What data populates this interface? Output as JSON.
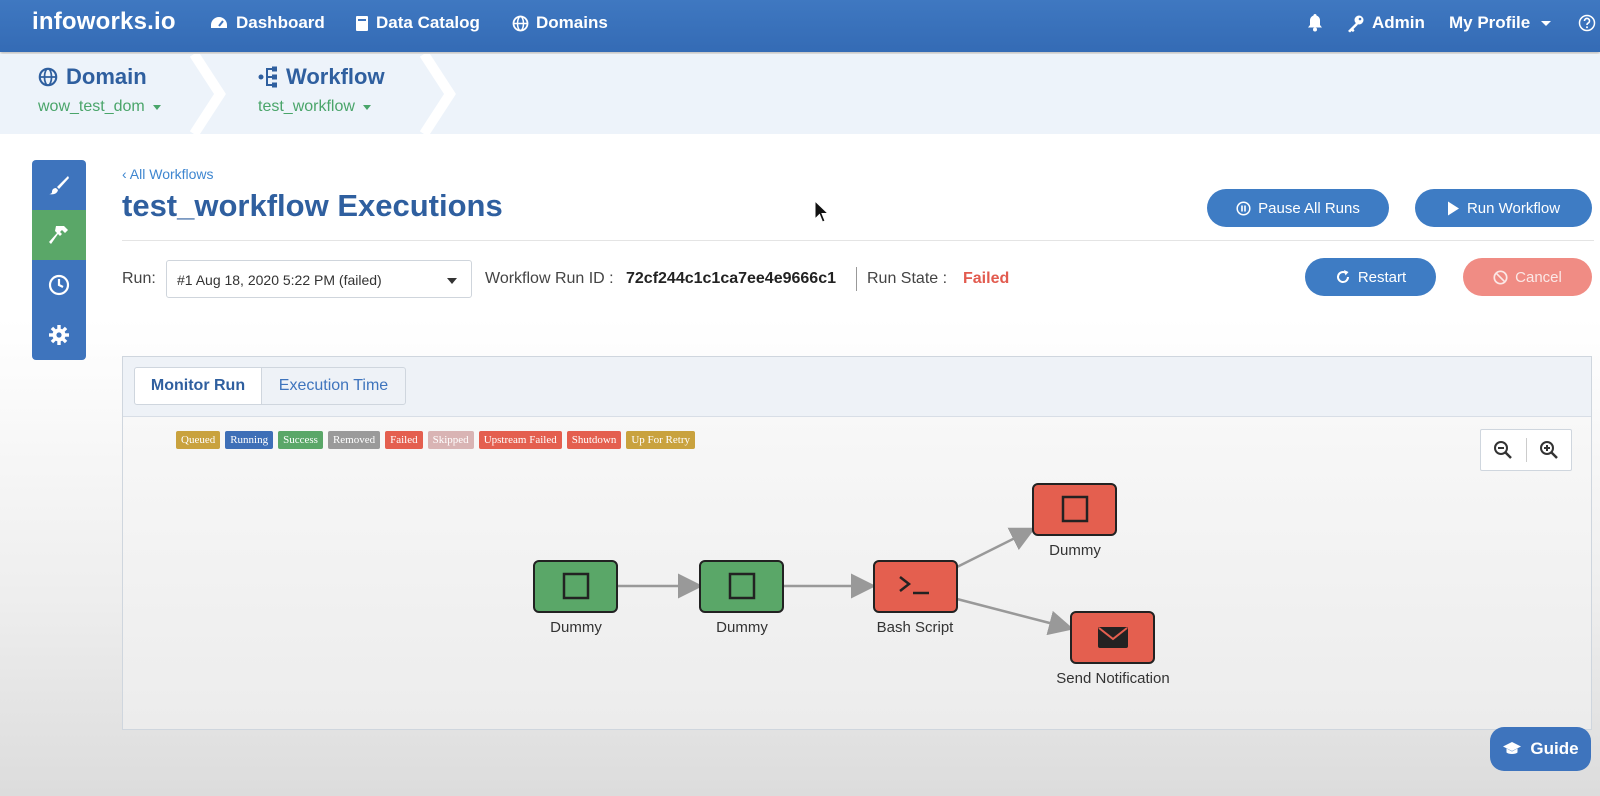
{
  "topnav": {
    "brand": "infoworks.io",
    "dashboard": "Dashboard",
    "data_catalog": "Data Catalog",
    "domains": "Domains",
    "admin": "Admin",
    "my_profile": "My Profile",
    "icons": {
      "bell": "bell-icon",
      "help": "help-icon",
      "key": "key-icon"
    }
  },
  "breadcrumb": {
    "domain_title": "Domain",
    "domain_value": "wow_test_dom",
    "workflow_title": "Workflow",
    "workflow_value": "test_workflow"
  },
  "rail": [
    "brush-icon",
    "hammer-icon",
    "clock-icon",
    "gear-icon"
  ],
  "main": {
    "back_link": "‹ All Workflows",
    "title": "test_workflow Executions",
    "pause_all_runs": "Pause All Runs",
    "run_workflow": "Run Workflow",
    "restart": "Restart",
    "cancel": "Cancel"
  },
  "run": {
    "label": "Run:",
    "selected": "#1 Aug 18, 2020 5:22 PM (failed)",
    "run_id_label": "Workflow Run ID :",
    "run_id_value": "72cf244c1c1ca7ee4e9666c1",
    "state_label": "Run State :",
    "state_value": "Failed"
  },
  "tabs": {
    "monitor_run": "Monitor Run",
    "execution_time": "Execution Time"
  },
  "legend": [
    {
      "label": "Queued",
      "color": "#c9a23e"
    },
    {
      "label": "Running",
      "color": "#3e6fb7"
    },
    {
      "label": "Success",
      "color": "#5aa768"
    },
    {
      "label": "Removed",
      "color": "#9a9a9a"
    },
    {
      "label": "Failed",
      "color": "#e45f4f"
    },
    {
      "label": "Skipped",
      "color": "#d9b4b4"
    },
    {
      "label": "Upstream Failed",
      "color": "#e45f4f"
    },
    {
      "label": "Shutdown",
      "color": "#e45f4f"
    },
    {
      "label": "Up For Retry",
      "color": "#c9a23e"
    }
  ],
  "nodes": [
    {
      "label": "Dummy",
      "status": "success",
      "icon": "square-icon"
    },
    {
      "label": "Dummy",
      "status": "success",
      "icon": "square-icon"
    },
    {
      "label": "Bash Script",
      "status": "failed",
      "icon": "terminal-icon"
    },
    {
      "label": "Dummy",
      "status": "failed",
      "icon": "square-icon"
    },
    {
      "label": "Send Notification",
      "status": "failed",
      "icon": "envelope-icon"
    }
  ],
  "colors": {
    "accent": "#3e74bd",
    "success": "#5aa768",
    "failed": "#e45f4f"
  },
  "guide": "Guide"
}
